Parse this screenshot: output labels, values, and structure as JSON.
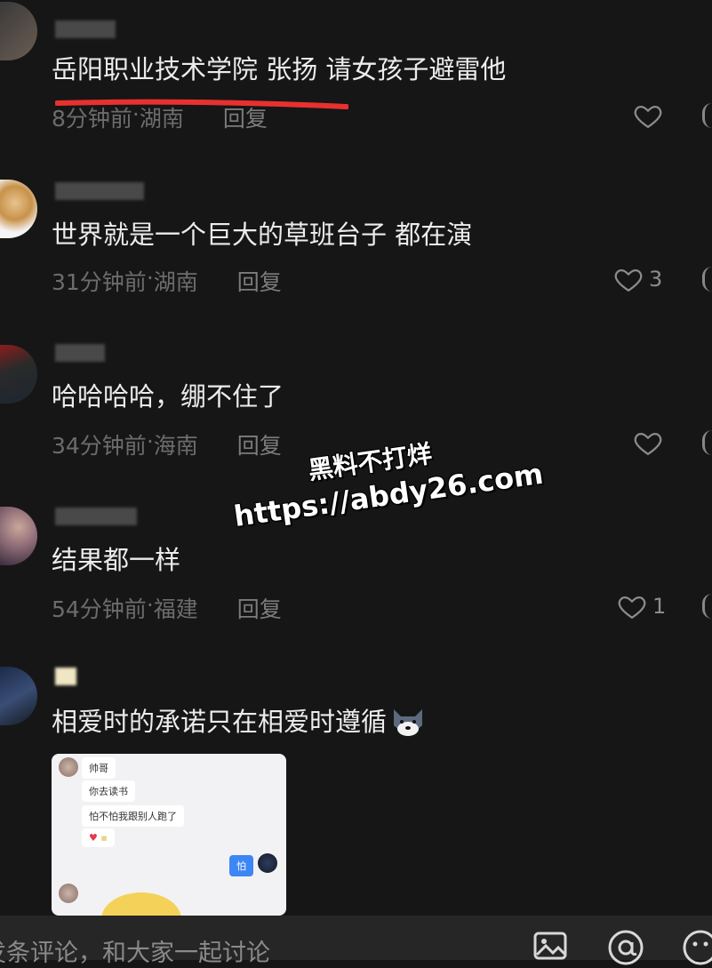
{
  "comments": [
    {
      "text": "岳阳职业技术学院 张扬  请女孩子避雷他",
      "time": "8分钟前",
      "location": "湖南",
      "reply_label": "回复",
      "likes": ""
    },
    {
      "text": "世界就是一个巨大的草班台子 都在演",
      "time": "31分钟前",
      "location": "湖南",
      "reply_label": "回复",
      "likes": "3"
    },
    {
      "text": "哈哈哈哈，绷不住了",
      "time": "34分钟前",
      "location": "海南",
      "reply_label": "回复",
      "likes": ""
    },
    {
      "text": "结果都一样",
      "time": "54分钟前",
      "location": "福建",
      "reply_label": "回复",
      "likes": "1"
    },
    {
      "text": "相爱时的承诺只在相爱时遵循",
      "time": "",
      "location": "",
      "reply_label": "",
      "likes": ""
    }
  ],
  "separator": " · ",
  "attachment": {
    "contact_name": "帅哥",
    "messages": [
      "你去读书",
      "怕不怕我跟别人跑了",
      "怕"
    ]
  },
  "watermark": {
    "line1": "黑料不打烊",
    "line2": "https://abdy26.com"
  },
  "bottom_bar": {
    "input_placeholder": "发条评论，和大家一起讨论"
  },
  "colors": {
    "background": "#161616",
    "text": "#ececec",
    "meta": "#6c6c6c",
    "underline": "#e8312f"
  }
}
